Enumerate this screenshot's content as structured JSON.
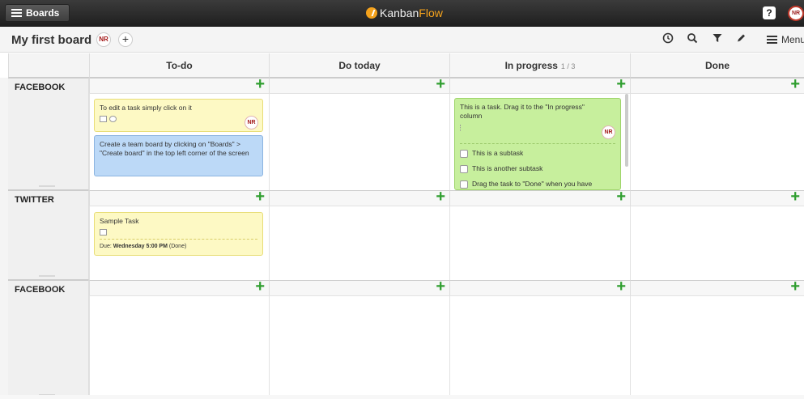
{
  "topbar": {
    "boards_label": "Boards",
    "logo_part1": "Kanban",
    "logo_part2": "Flow",
    "help_label": "?",
    "user_initials": "NR"
  },
  "header": {
    "board_title": "My first board",
    "member_initials": "NR",
    "add_member_label": "+",
    "menu_label": "Menu"
  },
  "columns": [
    {
      "title": "To-do",
      "count": ""
    },
    {
      "title": "Do today",
      "count": ""
    },
    {
      "title": "In progress",
      "count": "1 / 3"
    },
    {
      "title": "Done",
      "count": ""
    }
  ],
  "swimlanes": [
    {
      "name": "FACEBOOK"
    },
    {
      "name": "TWITTER"
    },
    {
      "name": "FACEBOOK"
    }
  ],
  "add_task_label": "+",
  "tasks": {
    "edit_task": {
      "text": "To edit a task simply click on it",
      "assignee": "NR"
    },
    "team_board": {
      "text": "Create a team board by clicking on \"Boards\" > \"Create board\" in the top left corner of the screen"
    },
    "drag_task": {
      "text": "This is a task. Drag it to the \"In progress\" column",
      "assignee": "NR",
      "subtasks": [
        "This is a subtask",
        "This is another subtask",
        "Drag the task to \"Done\" when you have"
      ]
    },
    "sample": {
      "text": "Sample Task",
      "due_prefix": "Due:",
      "due_value": "Wednesday 5:00 PM",
      "due_suffix": "(Done)"
    }
  },
  "colors": {
    "accent": "#f4a21c",
    "add_green": "#2f9e2f",
    "yellow_task": "#fdf9c4",
    "blue_task": "#bcd9f7",
    "green_task": "#c7ef9d"
  }
}
